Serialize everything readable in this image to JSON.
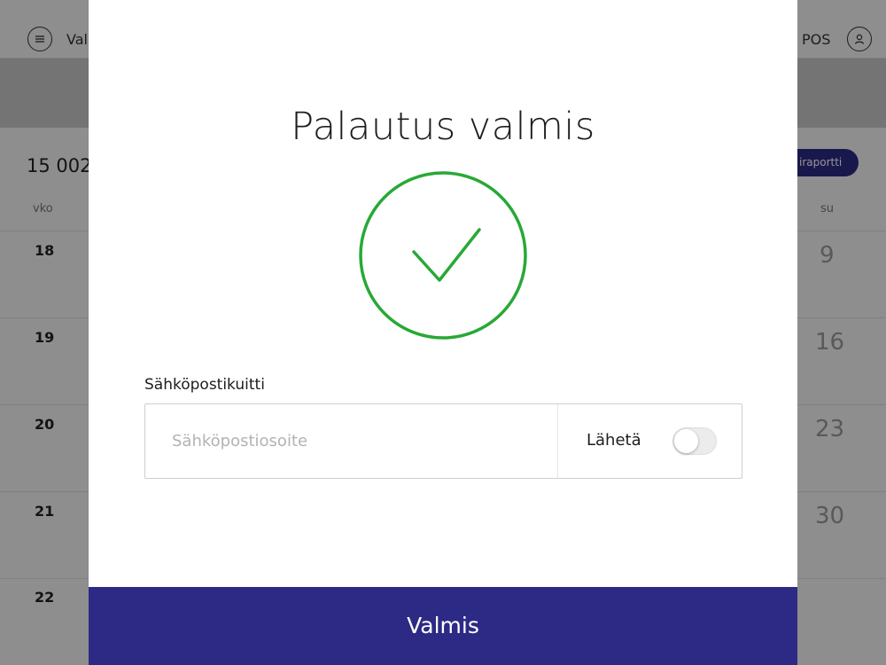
{
  "app": {
    "title": "Val",
    "pos_label": "POS",
    "summary_value": "15 002",
    "report_button_label": "iraportti",
    "columns": {
      "week": "vko",
      "sunday": "su"
    },
    "weeks": [
      {
        "week": "18",
        "sunday": "9"
      },
      {
        "week": "19",
        "sunday": "16"
      },
      {
        "week": "20",
        "sunday": "23"
      },
      {
        "week": "21",
        "sunday": "30"
      },
      {
        "week": "22",
        "sunday": ""
      }
    ]
  },
  "modal": {
    "title": "Palautus valmis",
    "status_icon": "check-circle-icon",
    "success_color": "#27a935",
    "email_receipt": {
      "label": "Sähköpostikuitti",
      "placeholder": "Sähköpostiosoite",
      "value": "",
      "send_label": "Lähetä",
      "send_enabled": false
    },
    "done_button_label": "Valmis",
    "accent_color": "#2c2a85"
  }
}
